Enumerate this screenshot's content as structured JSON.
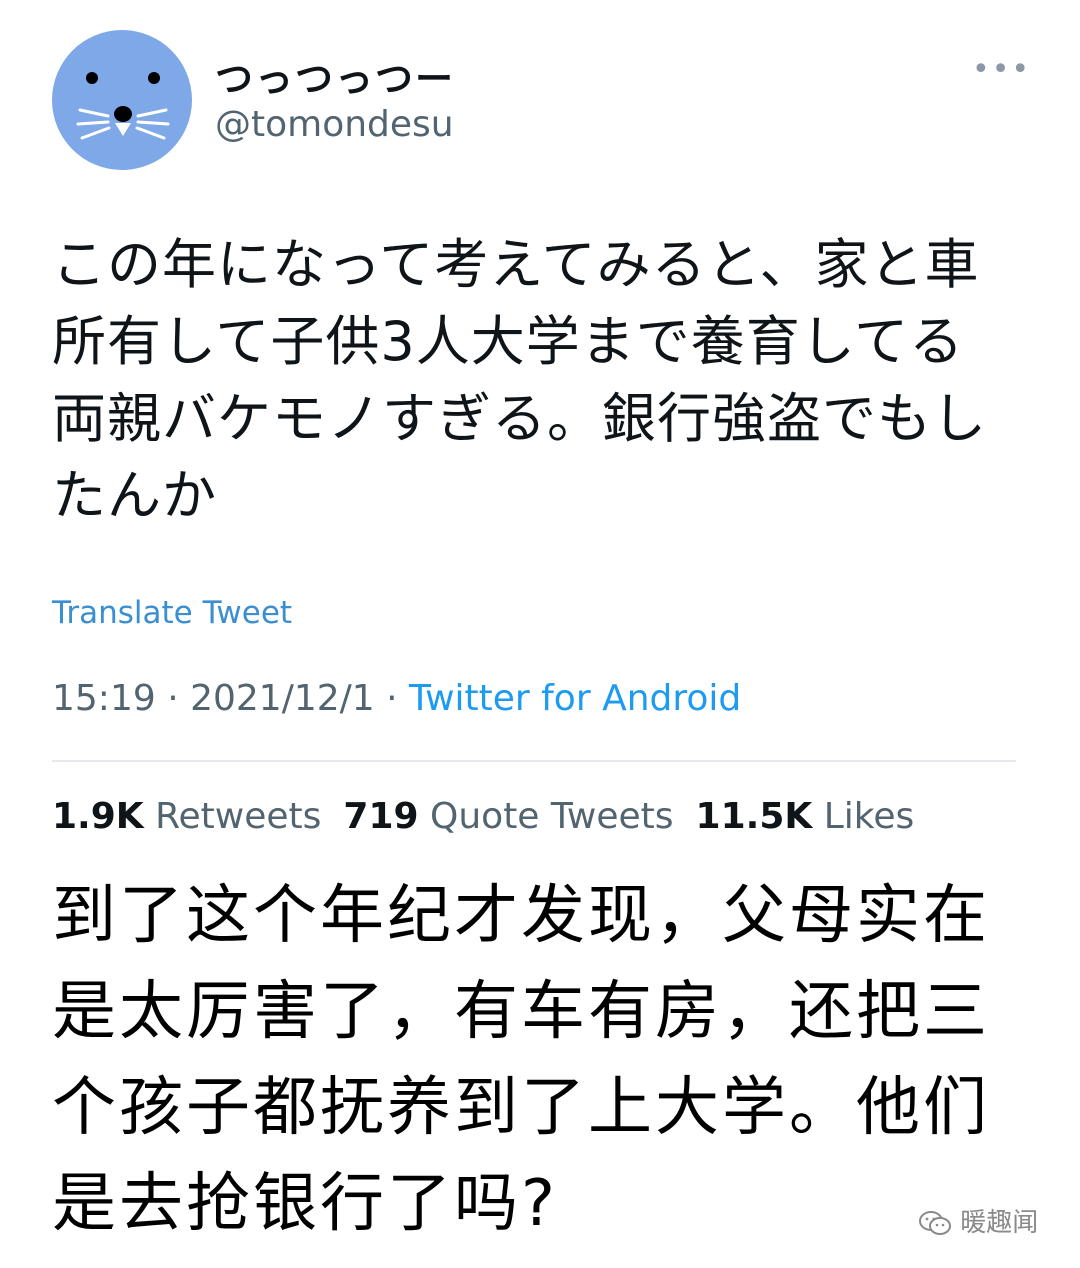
{
  "tweet": {
    "display_name": "つっつっつー",
    "handle": "@tomondesu",
    "more_icon": "more-horizontal-icon",
    "avatar_colors": {
      "bg": "#7fa8e8",
      "features": "#000000",
      "whiskers": "#ffffff"
    },
    "text_lines": [
      "この年になって考えてみると、家と車",
      "所有して子供3人大学まで養育してる",
      "両親バケモノすぎる。銀行強盗でもし",
      "たんか"
    ],
    "translate_label": "Translate Tweet",
    "time": "15:19",
    "separator": " · ",
    "date": "2021/12/1",
    "source": "Twitter for Android",
    "stats": {
      "retweets_count": "1.9K",
      "retweets_label": "Retweets",
      "quotes_count": "719",
      "quotes_label": "Quote Tweets",
      "likes_count": "11.5K",
      "likes_label": "Likes"
    }
  },
  "caption_lines": [
    "到了这个年纪才发现，父母实在",
    "是太厉害了，有车有房，还把三",
    "个孩子都抚养到了上大学。他们",
    "是去抢银行了吗?"
  ],
  "watermark": {
    "icon": "wechat-icon",
    "text": "暖趣闻"
  },
  "colors": {
    "link": "#1d9bf0",
    "muted": "#536471",
    "text": "#0f1419"
  }
}
